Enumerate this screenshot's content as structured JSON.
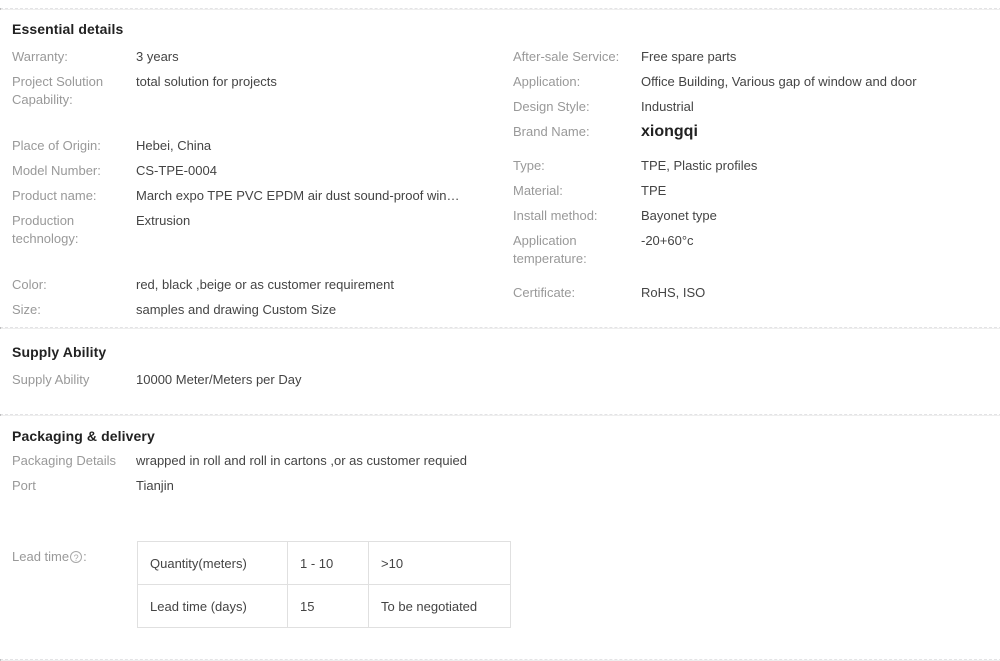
{
  "dividers": [
    "divider-top",
    "divider-mid-1",
    "divider-mid-2",
    "divider-bottom"
  ],
  "sections": {
    "essential": {
      "title": "Essential details",
      "left": [
        {
          "label": "Warranty:",
          "value": "3 years"
        },
        {
          "label": "Project Solution Capability:",
          "value": "total solution for projects"
        },
        {
          "label": "Place of Origin:",
          "value": "Hebei, China"
        },
        {
          "label": "Model Number:",
          "value": "CS-TPE-0004"
        },
        {
          "label": "Product name:",
          "value": "March expo TPE PVC EPDM air dust sound-proof win…"
        },
        {
          "label": "Production technology:",
          "value": "Extrusion"
        },
        {
          "label": "Color:",
          "value": "red, black ,beige or as customer requirement"
        },
        {
          "label": "Size:",
          "value": "samples and drawing Custom Size"
        }
      ],
      "right": [
        {
          "label": "After-sale Service:",
          "value": "Free spare parts"
        },
        {
          "label": "Application:",
          "value": "Office Building, Various gap of window and door"
        },
        {
          "label": "Design Style:",
          "value": "Industrial"
        },
        {
          "label": "Brand Name:",
          "value": "xiongqi"
        },
        {
          "label": "Type:",
          "value": "TPE, Plastic profiles"
        },
        {
          "label": "Material:",
          "value": "TPE"
        },
        {
          "label": "Install method:",
          "value": "Bayonet type"
        },
        {
          "label": "Application temperature:",
          "value": "-20+60°c"
        },
        {
          "label": "Certificate:",
          "value": "RoHS, ISO"
        }
      ]
    },
    "supply": {
      "title": "Supply Ability",
      "row": {
        "label": "Supply Ability",
        "value": "10000 Meter/Meters per Day"
      }
    },
    "packaging": {
      "title": "Packaging & delivery",
      "packaging_details": {
        "label": "Packaging Details",
        "value": "wrapped in roll and roll in cartons ,or as customer requied"
      },
      "port": {
        "label": "Port",
        "value": "Tianjin"
      }
    },
    "lead_time": {
      "label_prefix": "Lead time",
      "help_glyph": "?",
      "label_suffix": ":",
      "table": {
        "rows": [
          {
            "header": "Quantity(meters)",
            "a": "1 - 10",
            "b": ">10"
          },
          {
            "header": "Lead time (days)",
            "a": "15",
            "b": "To be negotiated"
          }
        ]
      }
    }
  },
  "colors": {
    "label_gray": "#999999",
    "value_gray": "#444444",
    "heading_dark": "#222222",
    "divider": "#e3e3e5",
    "table_border": "#e0e0e0"
  }
}
